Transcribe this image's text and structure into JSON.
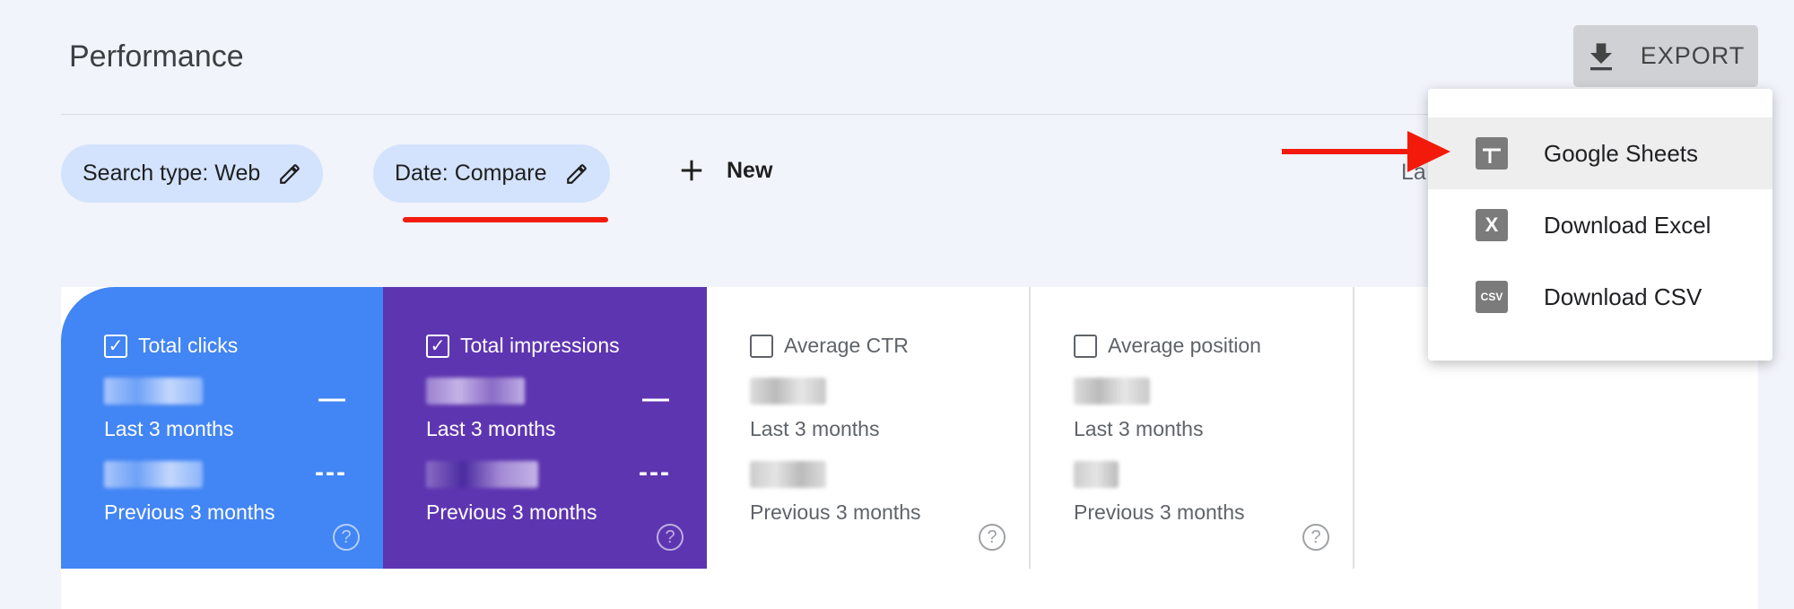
{
  "header": {
    "title": "Performance",
    "export_label": "EXPORT"
  },
  "filters": {
    "chips": [
      {
        "label": "Search type: Web"
      },
      {
        "label": "Date: Compare"
      }
    ],
    "new_label": "New",
    "partial_text": "La"
  },
  "metrics": [
    {
      "label": "Total clicks",
      "checked": true,
      "current_period": "Last 3 months",
      "previous_period": "Previous 3 months",
      "color": "#4285f4"
    },
    {
      "label": "Total impressions",
      "checked": true,
      "current_period": "Last 3 months",
      "previous_period": "Previous 3 months",
      "color": "#5e35b1"
    },
    {
      "label": "Average CTR",
      "checked": false,
      "current_period": "Last 3 months",
      "previous_period": "Previous 3 months"
    },
    {
      "label": "Average position",
      "checked": false,
      "current_period": "Last 3 months",
      "previous_period": "Previous 3 months"
    }
  ],
  "export_menu": {
    "items": [
      {
        "label": "Google Sheets",
        "icon": "google-sheets-icon",
        "highlighted": true
      },
      {
        "label": "Download Excel",
        "icon": "excel-icon",
        "glyph": "X"
      },
      {
        "label": "Download CSV",
        "icon": "csv-icon",
        "glyph": "CSV"
      }
    ]
  },
  "annotation_color": "#f21b0b"
}
